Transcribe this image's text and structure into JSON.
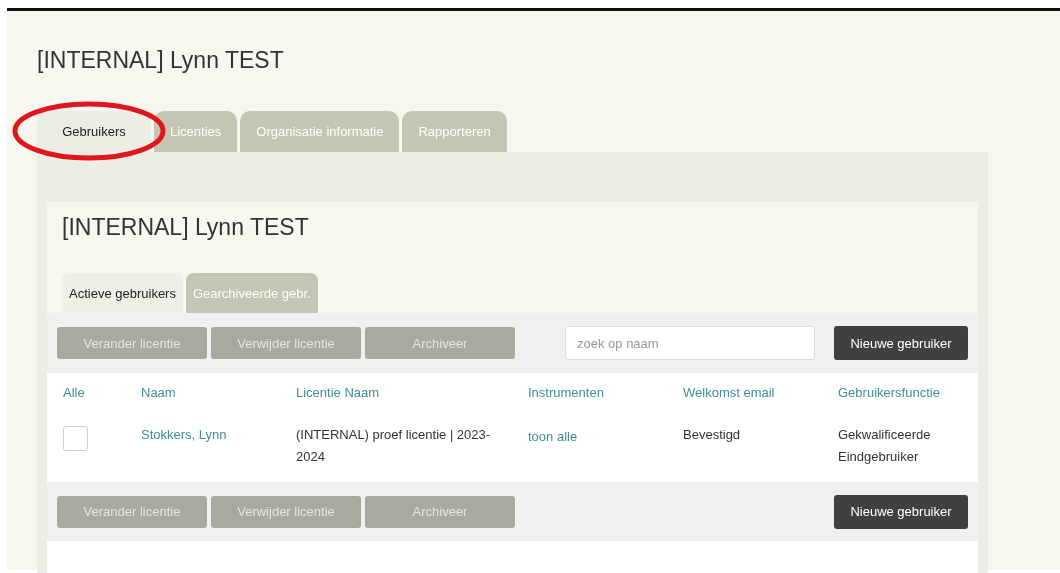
{
  "title": "[INTERNAL] Lynn TEST",
  "tabs": [
    {
      "label": "Gebruikers",
      "selected": true
    },
    {
      "label": "Licenties",
      "selected": false
    },
    {
      "label": "Organisatie informatie",
      "selected": false
    },
    {
      "label": "Rapporteren",
      "selected": false
    }
  ],
  "annotation": {
    "kind": "ellipse",
    "color": "#e0161e"
  },
  "panel": {
    "title": "[INTERNAL] Lynn TEST",
    "subtabs": [
      {
        "label": "Actieve gebruikers",
        "selected": true
      },
      {
        "label": "Gearchiveerde gebr.",
        "selected": false
      }
    ],
    "toolbar_top": {
      "buttons": [
        {
          "label": "Verander licentie",
          "disabled": true
        },
        {
          "label": "Verwijder licentie",
          "disabled": true
        },
        {
          "label": "Archiveer",
          "disabled": true
        }
      ],
      "search": {
        "placeholder": "zoek op naam"
      },
      "new_button": "Nieuwe gebruiker"
    },
    "table": {
      "columns": [
        "Alle",
        "Naam",
        "Licentie Naam",
        "Instrumenten",
        "Welkomst email",
        "Gebruikersfunctie"
      ],
      "rows": [
        {
          "checked": false,
          "name": "Stokkers, Lynn",
          "license": "(INTERNAL) proef licentie | 2023-2024",
          "instruments": "toon alle",
          "welcome_email": "Bevestigd",
          "role": "Gekwalificeerde Eindgebruiker"
        }
      ]
    },
    "toolbar_bottom": {
      "buttons": [
        {
          "label": "Verander licentie",
          "disabled": true
        },
        {
          "label": "Verwijder licentie",
          "disabled": true
        },
        {
          "label": "Archiveer",
          "disabled": true
        }
      ],
      "new_button": "Nieuwe gebruiker"
    }
  }
}
